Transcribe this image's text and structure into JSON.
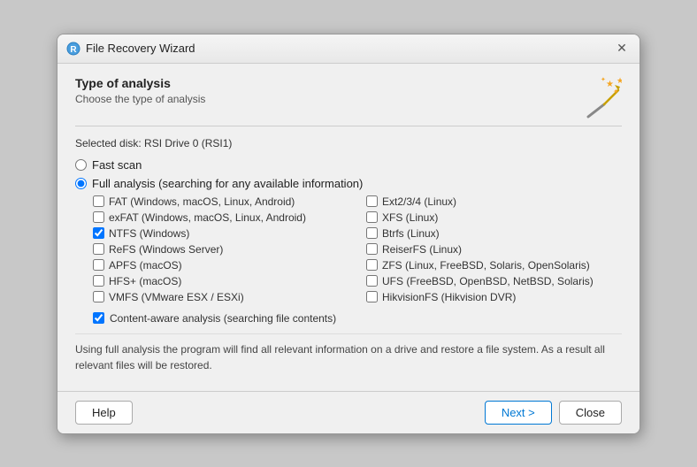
{
  "titleBar": {
    "icon": "file-recovery-icon",
    "title": "File Recovery Wizard",
    "closeLabel": "✕"
  },
  "header": {
    "title": "Type of analysis",
    "subtitle": "Choose the type of analysis"
  },
  "selectedDisk": "Selected disk: RSI Drive 0 (RSI1)",
  "analysisOptions": [
    {
      "id": "fast",
      "label": "Fast scan",
      "checked": false
    },
    {
      "id": "full",
      "label": "Full analysis (searching for any available information)",
      "checked": true
    }
  ],
  "fsOptions": [
    {
      "id": "fat",
      "label": "FAT (Windows, macOS, Linux, Android)",
      "checked": false,
      "col": 0
    },
    {
      "id": "ext234",
      "label": "Ext2/3/4 (Linux)",
      "checked": false,
      "col": 1
    },
    {
      "id": "exfat",
      "label": "exFAT (Windows, macOS, Linux, Android)",
      "checked": false,
      "col": 0
    },
    {
      "id": "xfs",
      "label": "XFS (Linux)",
      "checked": false,
      "col": 1
    },
    {
      "id": "ntfs",
      "label": "NTFS (Windows)",
      "checked": true,
      "col": 0
    },
    {
      "id": "btrfs",
      "label": "Btrfs (Linux)",
      "checked": false,
      "col": 1
    },
    {
      "id": "refs",
      "label": "ReFS (Windows Server)",
      "checked": false,
      "col": 0
    },
    {
      "id": "reiserfs",
      "label": "ReiserFS (Linux)",
      "checked": false,
      "col": 1
    },
    {
      "id": "apfs",
      "label": "APFS (macOS)",
      "checked": false,
      "col": 0
    },
    {
      "id": "zfs",
      "label": "ZFS (Linux, FreeBSD, Solaris, OpenSolaris)",
      "checked": false,
      "col": 1
    },
    {
      "id": "hfsplus",
      "label": "HFS+ (macOS)",
      "checked": false,
      "col": 0
    },
    {
      "id": "ufs",
      "label": "UFS (FreeBSD, OpenBSD, NetBSD, Solaris)",
      "checked": false,
      "col": 1
    },
    {
      "id": "vmfs",
      "label": "VMFS (VMware ESX / ESXi)",
      "checked": false,
      "col": 0
    },
    {
      "id": "hikvision",
      "label": "HikvisionFS (Hikvision DVR)",
      "checked": false,
      "col": 1
    }
  ],
  "contentAware": {
    "id": "contentAware",
    "label": "Content-aware analysis (searching file contents)",
    "checked": true
  },
  "infoText": "Using full analysis the program will find all relevant information on a drive and restore a file system. As a result all relevant files will be restored.",
  "footer": {
    "helpLabel": "Help",
    "nextLabel": "Next >",
    "closeLabel": "Close"
  }
}
